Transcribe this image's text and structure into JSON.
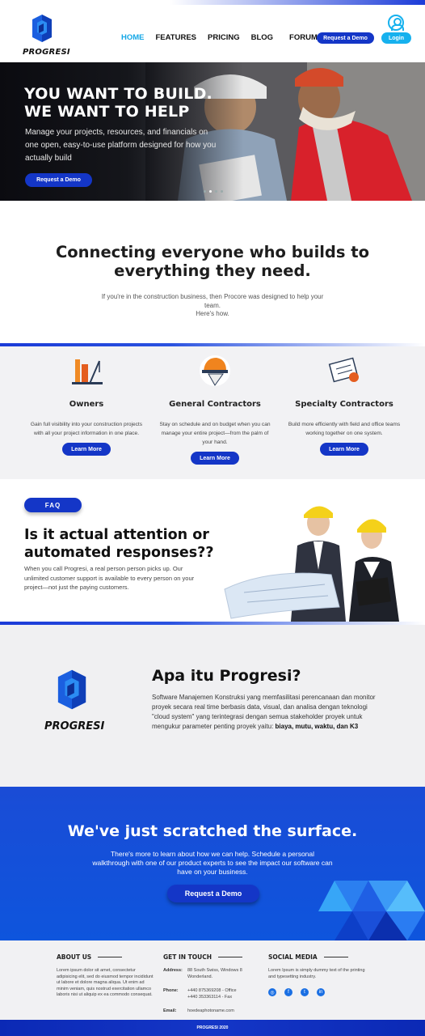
{
  "header": {
    "logo_text": "PROGRESI",
    "nav": [
      {
        "label": "HOME",
        "active": true
      },
      {
        "label": "FEATURES",
        "active": false
      },
      {
        "label": "PRICING",
        "active": false
      },
      {
        "label": "BLOG",
        "active": false
      },
      {
        "label": "FORUM",
        "active": false
      }
    ],
    "request_demo_label": "Request a Demo",
    "login_label": "Login",
    "user_icon": "user-circle-icon"
  },
  "hero": {
    "title_line1": "YOU WANT TO BUILD.",
    "title_line2": "WE WANT TO HELP",
    "subtitle": "Manage your projects, resources, and financials on one open, easy-to-use platform designed for how you actually build",
    "cta_label": "Request a Demo",
    "slides": 4,
    "active_slide": 2
  },
  "connect": {
    "title": "Connecting everyone who builds to everything they need.",
    "text": "If you're in the construction business, then Procore was designed to help your team.",
    "text2": "Here's how."
  },
  "roles": [
    {
      "title": "Owners",
      "text": "Gain full visibility into your construction projects with all your project information in one place.",
      "button": "Learn More",
      "icon": "construction-site-icon"
    },
    {
      "title": "General Contractors",
      "text": "Stay on schedule and on budget when you can manage your entire project—from the palm of your hand.",
      "button": "Learn More",
      "icon": "hard-hat-icon"
    },
    {
      "title": "Specialty Contractors",
      "text": "Build more efficiently with field and office teams working together on one system.",
      "button": "Learn More",
      "icon": "blueprint-icon"
    }
  ],
  "faq": {
    "badge": "FAQ",
    "title": "Is it actual attention or automated responses??",
    "text": "When you call Progresi, a real person person picks up. Our unlimited customer support is available to every person on your project—not just the paying customers."
  },
  "about": {
    "logo_text": "PROGRESI",
    "title": "Apa itu Progresi?",
    "text": "Software Manajemen Konstruksi yang memfasilitasi perencanaan dan monitor proyek secara real time berbasis data, visual, dan analisa dengan teknologi \"cloud system\" yang terintegrasi dengan semua stakeholder proyek untuk mengukur parameter penting proyek yaitu: ",
    "text_bold": "biaya, mutu, waktu, dan K3"
  },
  "surface": {
    "title": "We've just scratched the surface.",
    "text": "There's more to learn about how we can help. Schedule a personal walkthrough with one of our product experts to see the impact our software can have on your business.",
    "cta_label": "Request a Demo"
  },
  "footer": {
    "about_title": "ABOUT US",
    "about_text": "Lorem ipsum dolor sit amet, consectetur adipisicing elit, sed do eiusmod tempor incididunt ut labore et dolore magna aliqua. Ut enim ad minim veniam, quis nostrud exercitation ullamco laboris nisi ut aliquip ex ea commodo consequat.",
    "contact_title": "GET IN TOUCH",
    "contact": [
      {
        "label": "Address:",
        "value": "88 South Swiss, Windows 8 Wonderland."
      },
      {
        "label": "Phone:",
        "value": "+440 875369208 - Office +440 353363114 - Fax"
      },
      {
        "label": "Email:",
        "value": "hoedeaphotoname.com"
      }
    ],
    "social_title": "SOCIAL MEDIA",
    "social_text": "Lorem Ipsum is simply dummy text of the printing and typesetting industry.",
    "social": [
      "instagram-icon",
      "facebook-icon",
      "twitter-icon",
      "linkedin-icon"
    ],
    "copyright": "PROGRESI 2020"
  },
  "colors": {
    "brand_blue": "#1436c7",
    "accent_cyan": "#16b1ee",
    "surface_blue": "#0e55dd"
  }
}
